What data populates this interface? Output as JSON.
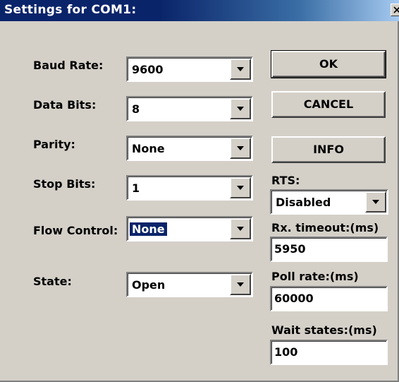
{
  "window": {
    "title": "Settings for COM1:",
    "close_label": "X"
  },
  "fields": {
    "baud_rate": {
      "label": "Baud Rate:",
      "value": "9600"
    },
    "data_bits": {
      "label": "Data Bits:",
      "value": "8"
    },
    "parity": {
      "label": "Parity:",
      "value": "None"
    },
    "stop_bits": {
      "label": "Stop Bits:",
      "value": "1"
    },
    "flow_control": {
      "label": "Flow Control:",
      "value": "None"
    },
    "state": {
      "label": "State:",
      "value": "Open"
    }
  },
  "buttons": {
    "ok": "OK",
    "cancel": "CANCEL",
    "info": "INFO"
  },
  "rts": {
    "label": "RTS:",
    "value": "Disabled"
  },
  "rx_timeout": {
    "label": "Rx. timeout:(ms)",
    "value": "5950"
  },
  "poll_rate": {
    "label": "Poll rate:(ms)",
    "value": "60000"
  },
  "wait_states": {
    "label": "Wait states:(ms)",
    "value": "100"
  },
  "icons": {
    "dropdown": "chevron-down-icon",
    "close": "close-icon"
  },
  "colors": {
    "title_bar_start": "#0a246a",
    "title_bar_end": "#a6caf0",
    "dialog_face": "#d4d0c8",
    "selection": "#0a246a"
  }
}
